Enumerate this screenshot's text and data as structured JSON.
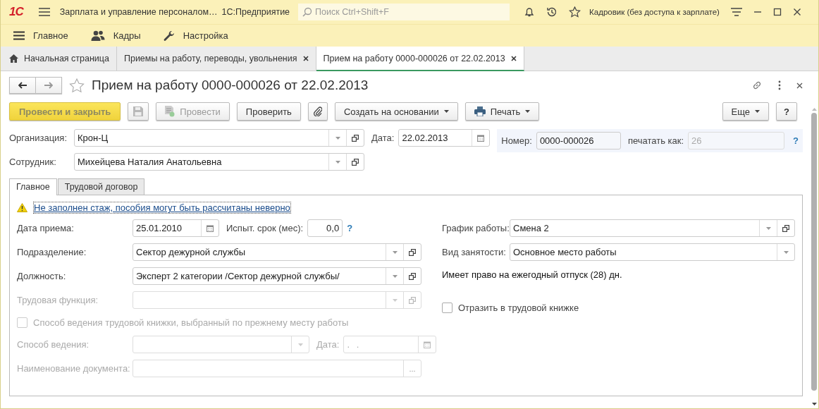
{
  "title_bar": {
    "logo": "1С",
    "title": "Зарплата и управление персоналом…",
    "platform": "1С:Предприятие",
    "search": {
      "placeholder": "Поиск Ctrl+Shift+F"
    },
    "user": "Кадровик (без доступа к зарплате)"
  },
  "sections": [
    {
      "label": "Главное"
    },
    {
      "label": "Кадры"
    },
    {
      "label": "Настройка"
    }
  ],
  "tabs": [
    {
      "label": "Начальная страница",
      "kind": "home",
      "selected": false
    },
    {
      "label": "Приемы на работу, переводы, увольнения",
      "kind": "closable",
      "selected": false
    },
    {
      "label": "Прием на работу 0000-000026 от 22.02.2013",
      "kind": "closable",
      "selected": true
    }
  ],
  "document": {
    "title": "Прием на работу 0000-000026 от 22.02.2013",
    "favorite": false,
    "toolbar": [
      {
        "label": "Провести и закрыть",
        "kind": "primary",
        "disabled": true
      },
      {
        "kind": "save",
        "disabled": true
      },
      {
        "label": "Провести",
        "kind": "post",
        "disabled": true
      },
      {
        "label": "Проверить",
        "kind": "plain",
        "disabled": false
      },
      {
        "kind": "attach"
      },
      {
        "label": "Создать на основании",
        "kind": "menu",
        "disabled": false
      },
      {
        "label": "Печать",
        "kind": "print",
        "disabled": false
      }
    ],
    "toolbar_right": [
      {
        "label": "Еще",
        "kind": "menu"
      },
      {
        "label": "?",
        "kind": "plain"
      }
    ],
    "organization": {
      "label": "Организация:",
      "value": "Крон-Ц"
    },
    "employee": {
      "label": "Сотрудник:",
      "value": "Михейцева Наталия Анатольевна"
    },
    "date": {
      "label": "Дата:",
      "value": "22.02.2013"
    },
    "number": {
      "label": "Номер:",
      "value": "0000-000026"
    },
    "print_as": {
      "label": "печатать как:",
      "value": "26",
      "disabled": true,
      "help": "?"
    }
  },
  "form_tabs": [
    {
      "label": "Главное",
      "selected": true
    },
    {
      "label": "Трудовой договор",
      "selected": false
    }
  ],
  "warning": "Не заполнен стаж, пособия могут быть рассчитаны неверно",
  "left_rows": [
    {
      "kind": "date_probation",
      "label": "Дата приема:",
      "value": "25.01.2010",
      "probation_label": "Испыт. срок (мес):",
      "probation_value": "0,0",
      "help": "?",
      "disabled": false
    },
    {
      "kind": "select",
      "label": "Подразделение:",
      "value": "Сектор дежурной службы",
      "disabled": false
    },
    {
      "kind": "select",
      "label": "Должность:",
      "value": "Эксперт 2 категории /Сектор дежурной службы/",
      "disabled": false
    },
    {
      "kind": "select",
      "label": "Трудовая функция:",
      "disabled": true
    },
    {
      "kind": "checkbox",
      "label": "Способ ведения трудовой книжки, выбранный по прежнему месту работы",
      "checked": false,
      "disabled": true
    },
    {
      "kind": "method_date",
      "label": "Способ ведения:",
      "date_label": "Дата:",
      "date_value": ". .",
      "disabled": true
    },
    {
      "kind": "ellipsis",
      "label": "Наименование документа:",
      "button": "...",
      "disabled": true
    }
  ],
  "right_rows": [
    {
      "kind": "select",
      "label": "График работы:",
      "value": "Смена 2",
      "open": true
    },
    {
      "kind": "select",
      "label": "Вид занятости:",
      "value": "Основное место работы",
      "open": false
    },
    {
      "kind": "note",
      "label": "Имеет право на ежегодный отпуск (28) дн."
    },
    {
      "kind": "checkbox",
      "label": "Отразить в трудовой книжке",
      "checked": false
    }
  ]
}
